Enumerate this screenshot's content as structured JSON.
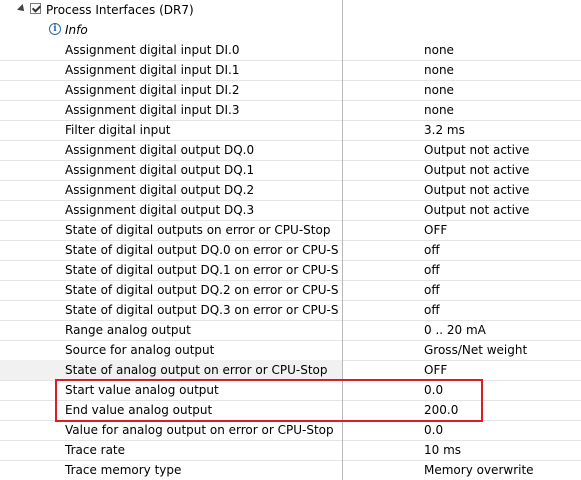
{
  "header": {
    "title": "Process Interfaces (DR7)"
  },
  "info": {
    "label": "Info"
  },
  "rows": [
    {
      "key": "Assignment digital input DI.0",
      "value": "none"
    },
    {
      "key": "Assignment digital input DI.1",
      "value": "none"
    },
    {
      "key": "Assignment digital input DI.2",
      "value": "none"
    },
    {
      "key": "Assignment digital input DI.3",
      "value": "none"
    },
    {
      "key": "Filter digital input",
      "value": "3.2 ms"
    },
    {
      "key": "Assignment digital output DQ.0",
      "value": "Output not active"
    },
    {
      "key": "Assignment digital output DQ.1",
      "value": "Output not active"
    },
    {
      "key": "Assignment digital output DQ.2",
      "value": "Output not active"
    },
    {
      "key": "Assignment digital output DQ.3",
      "value": "Output not active"
    },
    {
      "key": "State of digital outputs on error or CPU-Stop",
      "value": "OFF"
    },
    {
      "key": "State of digital output DQ.0 on error or CPU-S",
      "value": "off"
    },
    {
      "key": "State of digital output DQ.1 on error or CPU-S",
      "value": "off"
    },
    {
      "key": "State of digital output DQ.2 on error or CPU-S",
      "value": "off"
    },
    {
      "key": "State of digital output DQ.3 on error or CPU-S",
      "value": "off"
    },
    {
      "key": "Range analog output",
      "value": "0 .. 20 mA"
    },
    {
      "key": "Source for analog output",
      "value": "Gross/Net weight"
    },
    {
      "key": "State of analog output on error or CPU-Stop",
      "value": "OFF"
    },
    {
      "key": "Start value analog output",
      "value": "0.0"
    },
    {
      "key": "End value analog output",
      "value": "200.0"
    },
    {
      "key": "Value for analog output on error or CPU-Stop",
      "value": "0.0"
    },
    {
      "key": "Trace rate",
      "value": "10 ms"
    },
    {
      "key": "Trace memory type",
      "value": "Memory overwrite"
    }
  ]
}
